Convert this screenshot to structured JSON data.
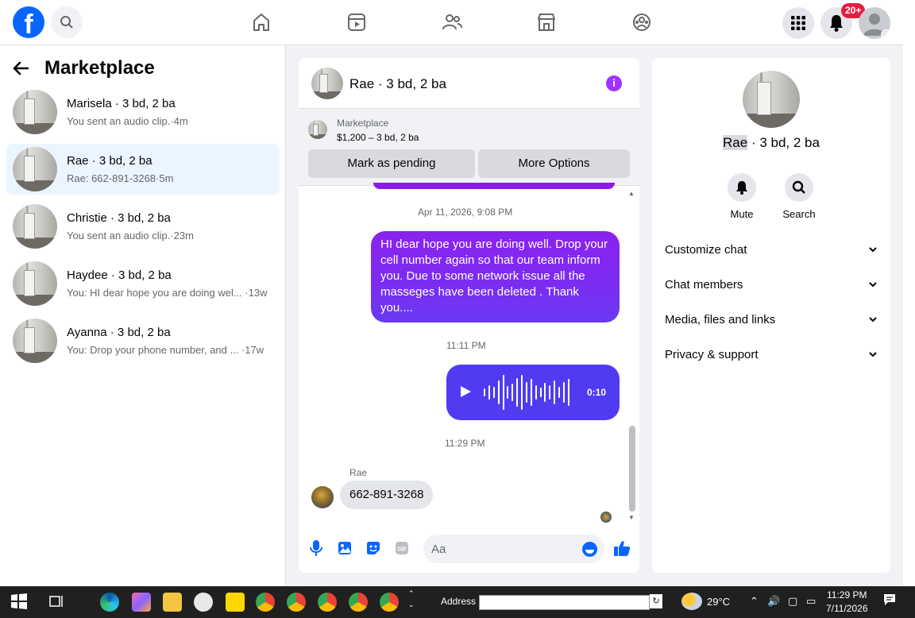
{
  "topbar": {
    "logo": "f",
    "notifications_badge": "20+",
    "nav": [
      "home-icon",
      "video-icon",
      "friends-icon",
      "marketplace-icon",
      "groups-icon"
    ]
  },
  "left": {
    "title": "Marketplace",
    "conversations": [
      {
        "name": "Marisela · 3 bd, 2 ba",
        "preview": "You sent an audio clip.·4m"
      },
      {
        "name": "Rae · 3 bd, 2 ba",
        "preview": "Rae: 662-891-3268·5m"
      },
      {
        "name": "Christie · 3 bd, 2 ba",
        "preview": "You sent an audio clip.·23m"
      },
      {
        "name": "Haydee · 3 bd, 2 ba",
        "preview": "You: HI dear hope you are doing wel... ·13w"
      },
      {
        "name": "Ayanna · 3 bd, 2 ba",
        "preview": "You: Drop your phone number, and ... ·17w"
      }
    ]
  },
  "chat": {
    "title": "Rae · 3 bd, 2 ba",
    "marketplace_label": "Marketplace",
    "listing": "$1,200 – 3 bd, 2 ba",
    "mark_pending": "Mark as pending",
    "more_options": "More Options",
    "ts1": "Apr 11, 2026, 9:08 PM",
    "out_message": "HI dear hope you are doing well.  Drop your cell number again so that our team inform you.  Due to some network issue all the masseges have been deleted . Thank you....",
    "ts2": "11:11 PM",
    "audio_duration": "0:10",
    "ts3": "11:29 PM",
    "sender": "Rae",
    "in_message": "662-891-3268",
    "input_placeholder": "Aa"
  },
  "right": {
    "title_name": "Rae",
    "title_rest": " · 3 bd, 2 ba",
    "mute": "Mute",
    "search": "Search",
    "sections": [
      "Customize chat",
      "Chat members",
      "Media, files and links",
      "Privacy & support"
    ]
  },
  "taskbar": {
    "address_label": "Address",
    "temperature": "29°C",
    "time": "11:29 PM",
    "date": "7/11/2026"
  },
  "colors": {
    "accent": "#0866ff",
    "bubble_out": "#7a2df0",
    "audio_bubble": "#4f3cf0",
    "badge": "#e41e3f"
  }
}
